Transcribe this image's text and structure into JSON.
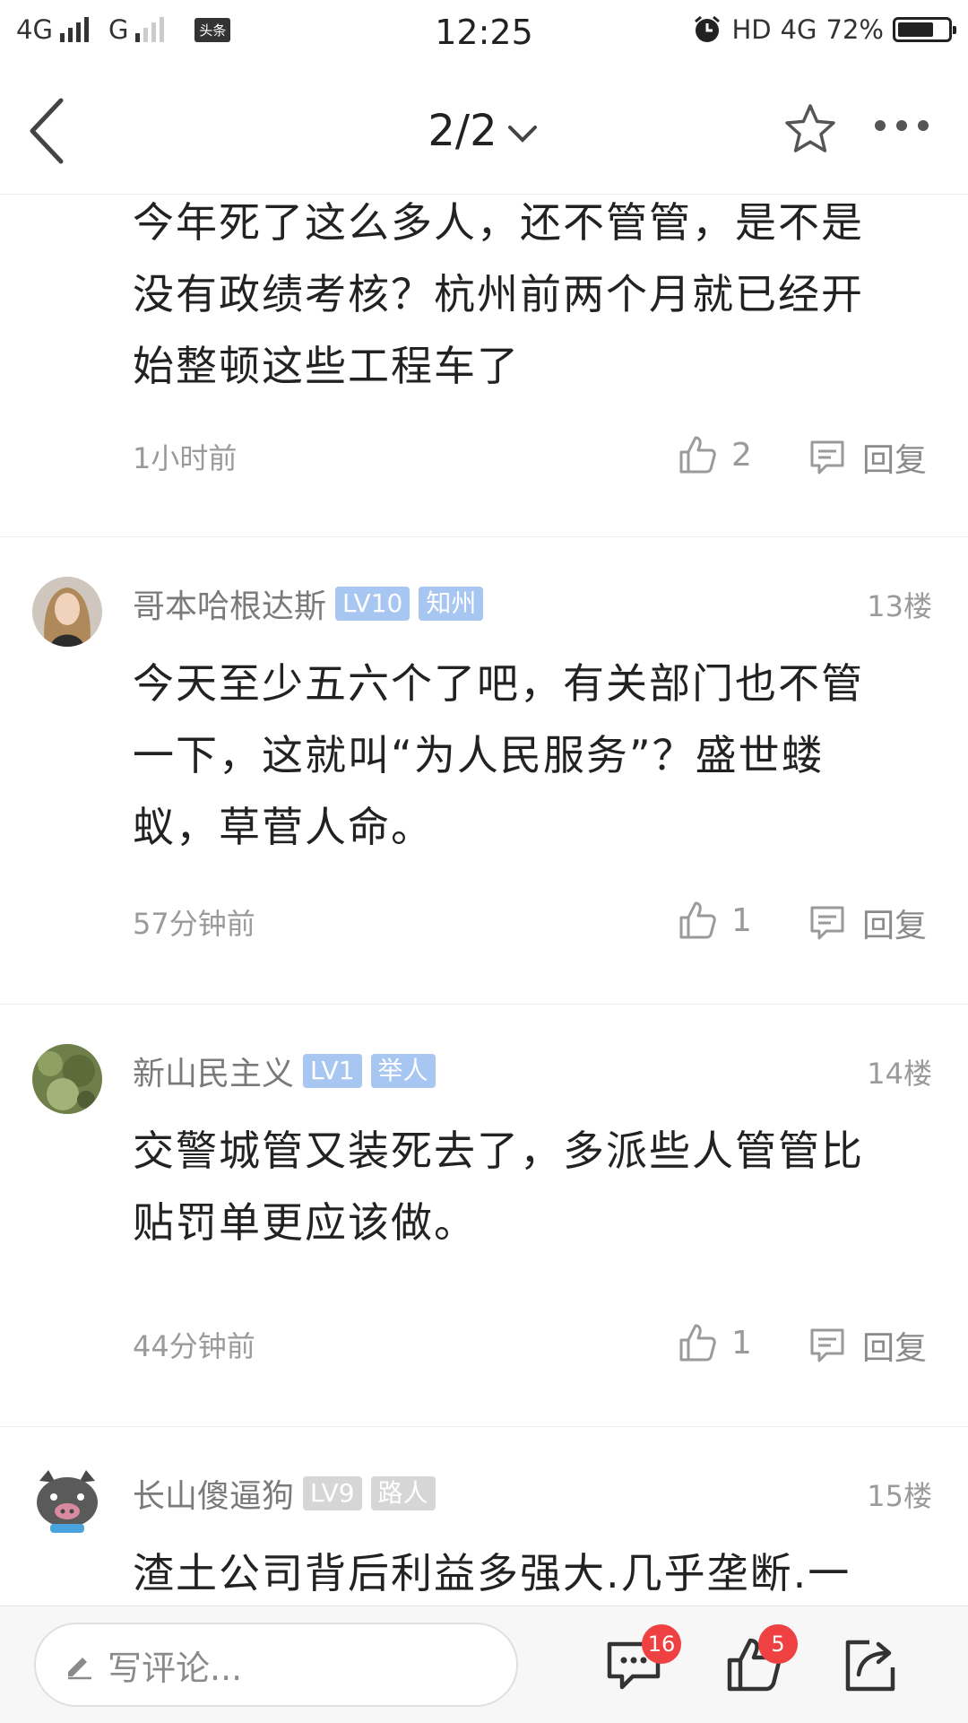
{
  "status_bar": {
    "network1": "4G",
    "network2": "G",
    "app_badge": "头条",
    "time": "12:25",
    "hd": "HD",
    "network3": "4G",
    "battery": "72%",
    "battery_level": 0.72
  },
  "nav": {
    "pager": "2/2"
  },
  "comments": [
    {
      "text": "今年死了这么多人，还不管管，是不是没有政绩考核？杭州前两个月就已经开始整顿这些工程车了",
      "time": "1小时前",
      "likes": "2",
      "reply_label": "回复"
    },
    {
      "username": "哥本哈根达斯",
      "level": "LV10",
      "title": "知州",
      "floor": "13楼",
      "text": "今天至少五六个了吧，有关部门也不管一下，这就叫“为人民服务”？盛世蝼蚁，草菅人命。",
      "time": "57分钟前",
      "likes": "1",
      "reply_label": "回复"
    },
    {
      "username": "新山民主义",
      "level": "LV1",
      "title": "举人",
      "floor": "14楼",
      "text": "交警城管又装死去了，多派些人管管比贴罚单更应该做。",
      "time": "44分钟前",
      "likes": "1",
      "reply_label": "回复"
    },
    {
      "username": "长山傻逼狗",
      "level": "LV9",
      "title": "路人",
      "floor": "15楼",
      "text": "渣土公司背后利益多强大.几乎垄断.一"
    }
  ],
  "bottom_bar": {
    "write_placeholder": "写评论...",
    "comment_count": "16",
    "like_count": "5"
  },
  "colors": {
    "badge_blue": "#a7c6f2",
    "badge_gray": "#d6d6d6",
    "count_red": "#f04142"
  }
}
